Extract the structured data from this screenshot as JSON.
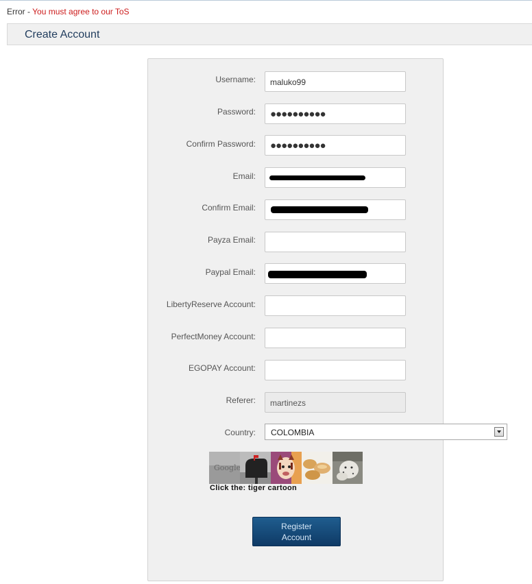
{
  "error": {
    "prefix": "Error",
    "separator": " - ",
    "message": "You must agree to our ToS"
  },
  "header": {
    "title": "Create Account"
  },
  "form": {
    "username": {
      "label": "Username:",
      "value": "maluko99"
    },
    "password": {
      "label": "Password:",
      "value": "●●●●●●●●●●"
    },
    "confirm_password": {
      "label": "Confirm Password:",
      "value": "●●●●●●●●●●"
    },
    "email": {
      "label": "Email:",
      "value": ""
    },
    "confirm_email": {
      "label": "Confirm Email:",
      "value": ""
    },
    "payza_email": {
      "label": "Payza Email:",
      "value": ""
    },
    "paypal_email": {
      "label": "Paypal Email:",
      "value": ""
    },
    "libertyreserve_account": {
      "label": "LibertyReserve Account:",
      "value": ""
    },
    "perfectmoney_account": {
      "label": "PerfectMoney Account:",
      "value": ""
    },
    "egopay_account": {
      "label": "EGOPAY Account:",
      "value": ""
    },
    "referer": {
      "label": "Referer:",
      "value": "martinezs"
    },
    "country": {
      "label": "Country:",
      "selected": "COLOMBIA"
    }
  },
  "captcha": {
    "prompt": "Click the: tiger cartoon",
    "tiles": [
      "google-logo-image",
      "mailbox-image",
      "tiger-cartoon-image",
      "bread-rolls-image",
      "snow-leopard-image"
    ]
  },
  "register_button": {
    "label": "Register Account"
  },
  "colors": {
    "error_red": "#cc1a1a",
    "title_blue": "#1f3b5c",
    "button_blue": "#0f3a66"
  }
}
